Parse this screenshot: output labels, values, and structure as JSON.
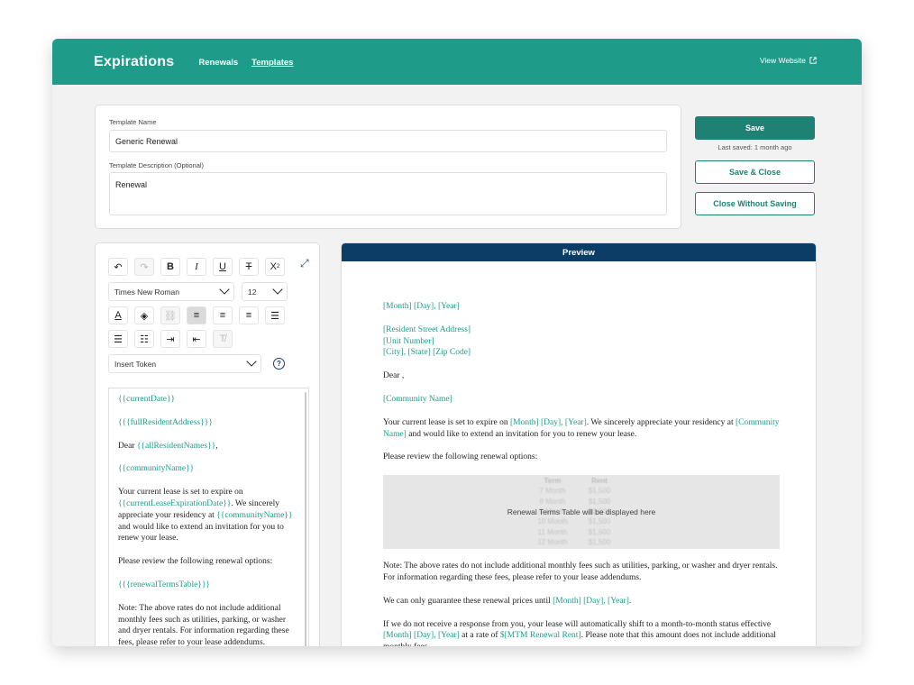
{
  "header": {
    "brand": "Expirations",
    "nav": [
      {
        "label": "Renewals"
      },
      {
        "label": "Templates"
      }
    ],
    "view_website": "View Website",
    "accent": "#1f9b8a"
  },
  "form": {
    "name_label": "Template Name",
    "name_value": "Generic Renewal",
    "desc_label": "Template Description (Optional)",
    "desc_value": "Renewal"
  },
  "actions": {
    "save": "Save",
    "last_saved": "Last saved: 1 month ago",
    "save_close": "Save & Close",
    "close_without_saving": "Close Without Saving"
  },
  "toolbar": {
    "font_family": "Times New Roman",
    "font_size": "12",
    "insert_token": "Insert Token",
    "icons": [
      "undo-icon",
      "redo-icon",
      "bold-icon",
      "italic-icon",
      "underline-icon",
      "strikethrough-icon",
      "superscript-icon",
      "expand-icon",
      "text-color-icon",
      "highlight-icon",
      "link-icon",
      "align-left-icon",
      "align-center-icon",
      "align-right-icon",
      "align-justify-icon",
      "bullet-list-icon",
      "numbered-list-icon",
      "indent-icon",
      "outdent-icon",
      "clear-format-icon",
      "help-icon"
    ]
  },
  "editor": {
    "t1": "{{currentDate}}",
    "t2": "{{{fullResidentAddress}}}",
    "dear": "Dear ",
    "t3": "{{allResidentNames}}",
    "comma": ",",
    "t4": "{{communityName}}",
    "p1a": "Your current lease is set to expire on ",
    "t5": "{{currentLeaseExpirationDate}}",
    "p1b": ". We sincerely appreciate your residency at ",
    "t6": "{{communityName}}",
    "p1c": " and would like to extend an invitation for you to renew your lease.",
    "p2": "Please review the following renewal options:",
    "t7": "{{{renewalTermsTable}}}",
    "p3": "Note: The above rates do not include additional monthly fees such as utilities, parking, or washer and dryer rentals. For information regarding these fees, please refer to your lease addendums."
  },
  "preview": {
    "title": "Preview",
    "date": "[Month] [Day], [Year]",
    "addr1": "[Resident Street Address]",
    "addr2": "[Unit Number]",
    "addr3": "[City], [State] [Zip Code]",
    "dear": "Dear ,",
    "community": "[Community Name]",
    "p1a": "Your current lease is set to expire on ",
    "p1date": "[Month] [Day], [Year]",
    "p1b": ". We sincerely appreciate your residency at ",
    "p1comm": "[Community Name]",
    "p1c": " and would like to extend an invitation for you to renew your lease.",
    "p2": "Please review the following renewal options:",
    "table_header": [
      "Term",
      "Rent"
    ],
    "table_rows": [
      [
        "7 Month",
        "$1,500"
      ],
      [
        "8 Month",
        "$1,500"
      ],
      [
        "9 Month",
        "$1,500"
      ],
      [
        "10 Month",
        "$1,500"
      ],
      [
        "11 Month",
        "$1,500"
      ],
      [
        "12 Month",
        "$1,500"
      ]
    ],
    "table_overlay": "Renewal Terms Table will be displayed here",
    "p3": "Note: The above rates do not include additional monthly fees such as utilities, parking, or washer and dryer rentals. For information regarding these fees, please refer to your lease addendums.",
    "p4a": "We can only guarantee these renewal prices until ",
    "p4date": "[Month] [Day], [Year]",
    "p4b": ".",
    "p5a": "If we do not receive a response from you, your lease will automatically shift to a month-to-month status effective ",
    "p5date": "[Month] [Day], [Year]",
    "p5b": " at a rate of ",
    "p5rent": "$[MTM Renewal Rent]",
    "p5c": ". Please note that this amount does not include additional monthly fees."
  }
}
